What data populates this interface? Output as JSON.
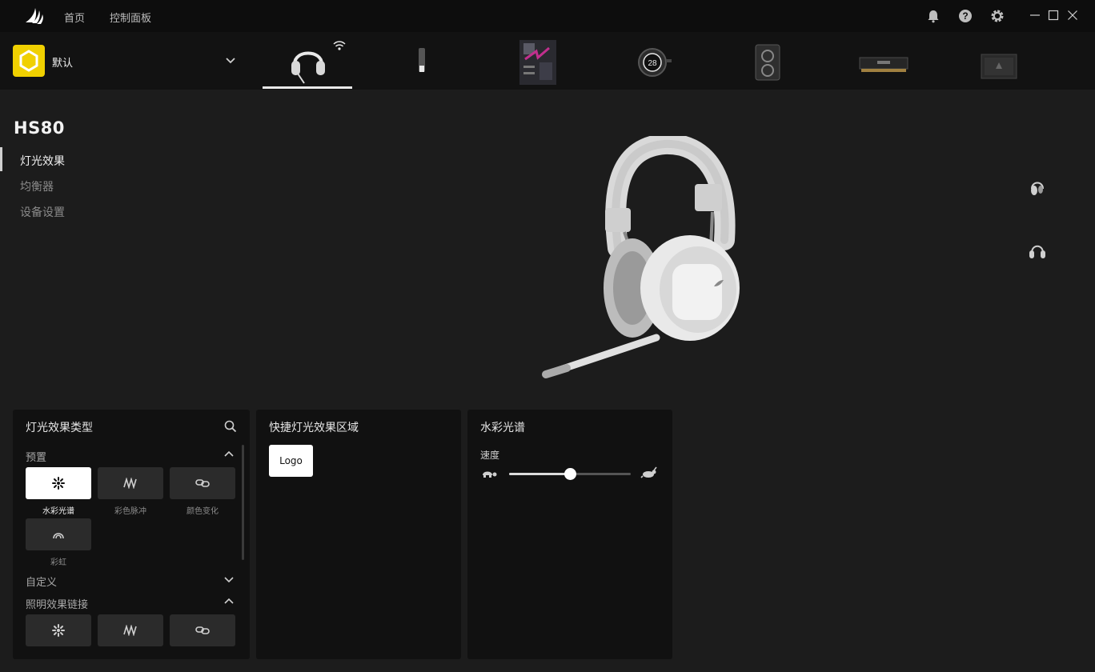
{
  "titlebar": {
    "nav": [
      {
        "label": "首页"
      },
      {
        "label": "控制面板"
      }
    ],
    "icons": [
      "bell-icon",
      "help-icon",
      "gear-icon"
    ],
    "window": [
      "minimize-icon",
      "maximize-icon",
      "close-icon"
    ]
  },
  "profile": {
    "name": "默认",
    "badge_color": "#f0d000"
  },
  "devices": [
    {
      "name": "headset",
      "selected": true
    },
    {
      "name": "usb-dongle",
      "selected": false
    },
    {
      "name": "motherboard",
      "selected": false
    },
    {
      "name": "aio-cooler",
      "selected": false
    },
    {
      "name": "pc-case",
      "selected": false
    },
    {
      "name": "ram-module",
      "selected": false
    },
    {
      "name": "gpu",
      "selected": false
    }
  ],
  "device": {
    "title": "HS80",
    "nav": [
      {
        "label": "灯光效果",
        "active": true
      },
      {
        "label": "均衡器",
        "active": false
      },
      {
        "label": "设备设置",
        "active": false
      }
    ]
  },
  "effects_panel": {
    "title": "灯光效果类型",
    "preset_section": "预置",
    "preset_tiles": [
      {
        "label": "水彩光谱",
        "icon": "spectrum-icon",
        "active": true
      },
      {
        "label": "彩色脉冲",
        "icon": "pulse-icon",
        "active": false
      },
      {
        "label": "颜色变化",
        "icon": "color-shift-icon",
        "active": false
      },
      {
        "label": "彩虹",
        "icon": "rainbow-icon",
        "active": false
      }
    ],
    "custom_section": "自定义",
    "link_section": "照明效果链接",
    "link_tiles": [
      {
        "icon": "spectrum-icon"
      },
      {
        "icon": "pulse-icon"
      },
      {
        "icon": "color-shift-icon"
      }
    ]
  },
  "zones_panel": {
    "title": "快捷灯光效果区域",
    "zone": "Logo"
  },
  "settings_panel": {
    "title": "水彩光谱",
    "speed_label": "速度",
    "speed_value": 0.5
  },
  "colors": {
    "accent_yellow": "#f0d000",
    "background": "#1c1c1c",
    "panel": "#111111"
  }
}
